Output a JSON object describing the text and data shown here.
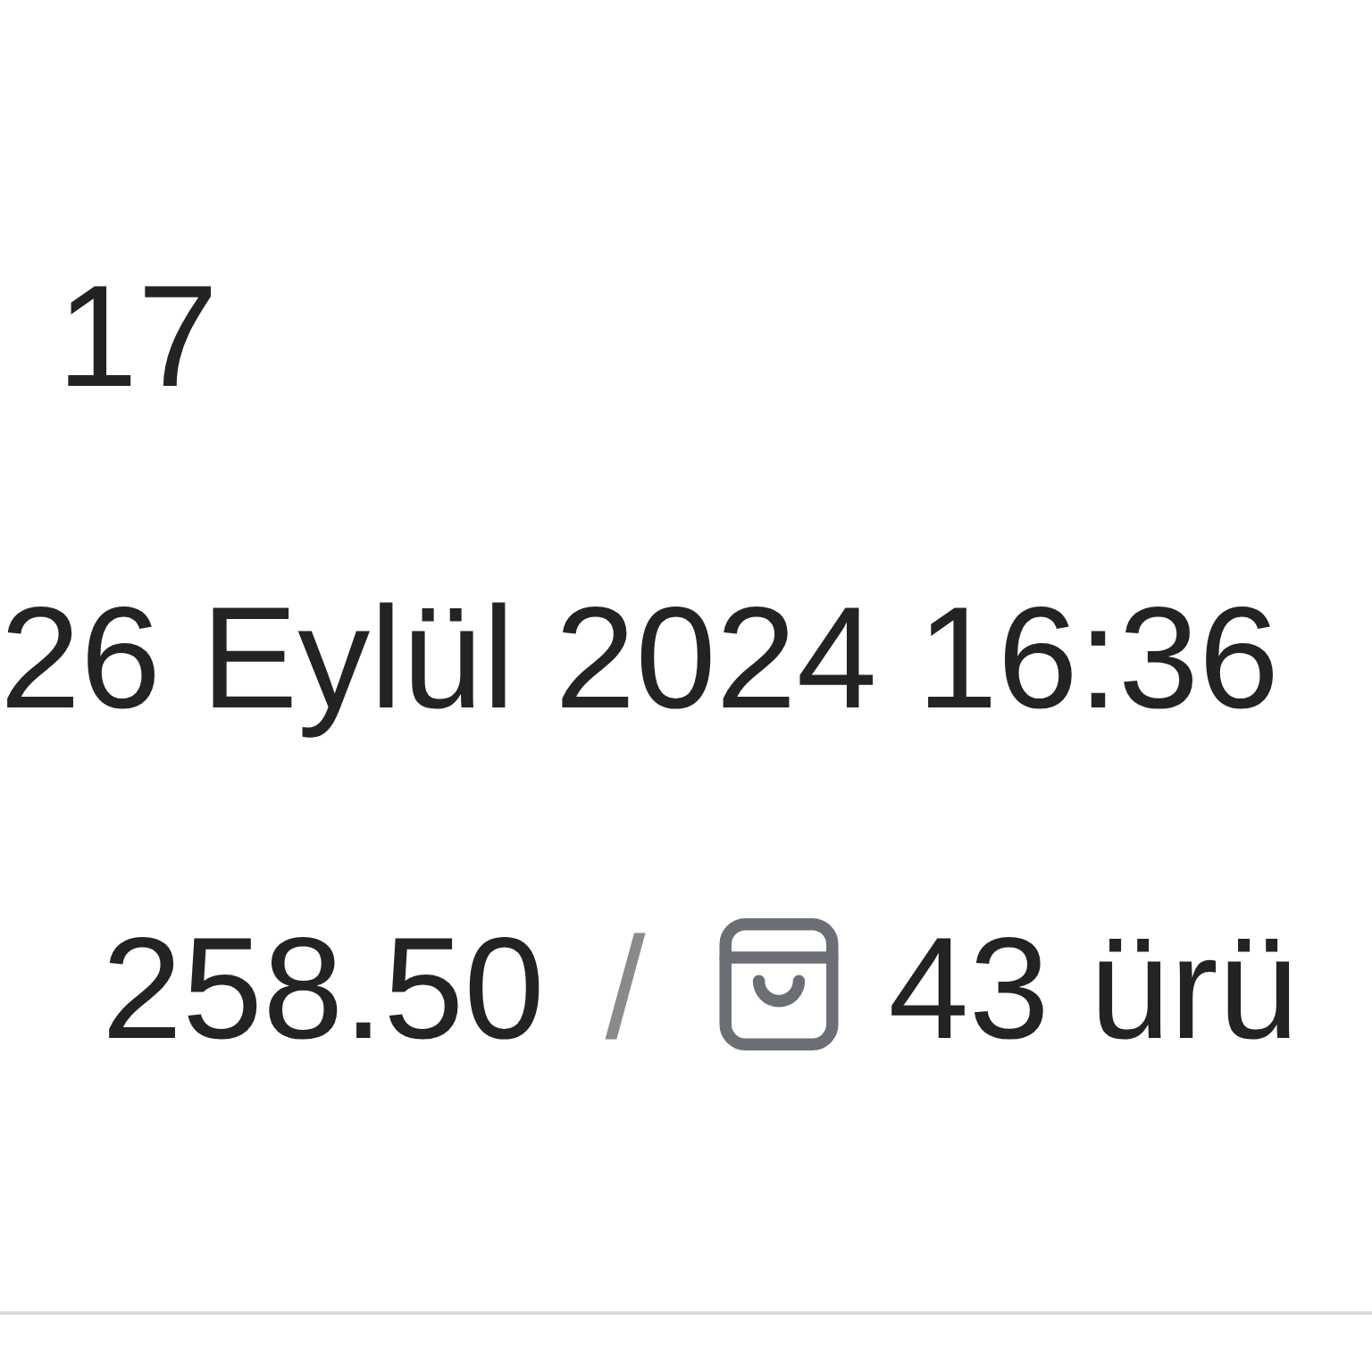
{
  "order_number": "17",
  "date": "26 Eylül 2024 16:36",
  "total": "258.50",
  "separator": "/",
  "item_count": "43 ürü"
}
